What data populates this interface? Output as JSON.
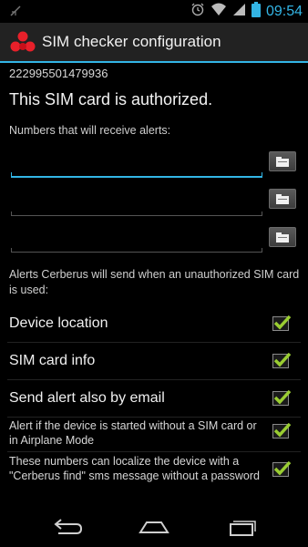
{
  "status_bar": {
    "time": "09:54",
    "icons": [
      "notification-icon",
      "alarm-icon",
      "wifi-icon",
      "signal-icon",
      "battery-icon"
    ]
  },
  "action_bar": {
    "title": "SIM checker configuration",
    "logo_icon": "cerberus-logo-icon"
  },
  "main": {
    "sim_number": "222995501479936",
    "status": "This SIM card is authorized.",
    "numbers_label": "Numbers that will receive alerts:",
    "phone_fields": [
      {
        "value": "",
        "placeholder": ""
      },
      {
        "value": "",
        "placeholder": ""
      },
      {
        "value": "",
        "placeholder": ""
      }
    ],
    "alerts_description": "Alerts Cerberus will send when an unauthorized SIM card is used:",
    "options": [
      {
        "label": "Device location",
        "checked": true
      },
      {
        "label": "SIM card info",
        "checked": true
      },
      {
        "label": "Send alert also by email",
        "checked": true
      },
      {
        "label": "Alert if the device is started without a SIM card or in Airplane Mode",
        "checked": true
      },
      {
        "label": "These numbers can localize the device with a \"Cerberus find\" sms message without a password",
        "checked": true
      }
    ]
  },
  "nav_bar": {
    "icons": [
      "back-icon",
      "home-icon",
      "recent-apps-icon"
    ]
  },
  "colors": {
    "accent": "#33b5e5",
    "check": "#9acd32",
    "logo": "#e8202a"
  }
}
